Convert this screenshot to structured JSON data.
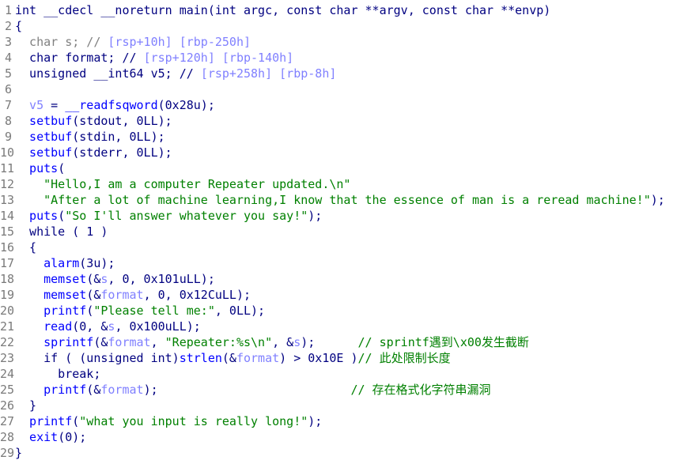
{
  "colors": {
    "keyword": "#000080",
    "function": "#0000ff",
    "variable": "#8080ff",
    "string": "#008000",
    "comment": "#008000",
    "gray": "#808080"
  },
  "lines": [
    [
      [
        "k",
        "int __cdecl __noreturn main(int argc, const char **argv, const char **envp)"
      ]
    ],
    [
      [
        "k",
        "{"
      ]
    ],
    [
      [
        "g",
        "  char s; // "
      ],
      [
        "a",
        "[rsp+10h] [rbp-250h]"
      ]
    ],
    [
      [
        "k",
        "  char format; // "
      ],
      [
        "a",
        "[rsp+120h] [rbp-140h]"
      ]
    ],
    [
      [
        "k",
        "  unsigned __int64 v5; // "
      ],
      [
        "a",
        "[rsp+258h] [rbp-8h]"
      ]
    ],
    [
      [
        "k",
        ""
      ]
    ],
    [
      [
        "v",
        "  v5"
      ],
      [
        "k",
        " = "
      ],
      [
        "f",
        "__readfsqword"
      ],
      [
        "k",
        "(0x28u);"
      ]
    ],
    [
      [
        "f",
        "  setbuf"
      ],
      [
        "k",
        "(stdout, 0LL);"
      ]
    ],
    [
      [
        "f",
        "  setbuf"
      ],
      [
        "k",
        "(stdin, 0LL);"
      ]
    ],
    [
      [
        "f",
        "  setbuf"
      ],
      [
        "k",
        "(stderr, 0LL);"
      ]
    ],
    [
      [
        "f",
        "  puts"
      ],
      [
        "k",
        "("
      ]
    ],
    [
      [
        "s",
        "    \"Hello,I am a computer Repeater updated.\\n\""
      ]
    ],
    [
      [
        "s",
        "    \"After a lot of machine learning,I know that the essence of man is a reread machine!\""
      ],
      [
        "k",
        ");"
      ]
    ],
    [
      [
        "f",
        "  puts"
      ],
      [
        "k",
        "("
      ],
      [
        "s",
        "\"So I'll answer whatever you say!\""
      ],
      [
        "k",
        ");"
      ]
    ],
    [
      [
        "k",
        "  while ( 1 )"
      ]
    ],
    [
      [
        "k",
        "  {"
      ]
    ],
    [
      [
        "f",
        "    alarm"
      ],
      [
        "k",
        "(3u);"
      ]
    ],
    [
      [
        "f",
        "    memset"
      ],
      [
        "k",
        "(&"
      ],
      [
        "v",
        "s"
      ],
      [
        "k",
        ", 0, 0x101uLL);"
      ]
    ],
    [
      [
        "f",
        "    memset"
      ],
      [
        "k",
        "(&"
      ],
      [
        "v",
        "format"
      ],
      [
        "k",
        ", 0, 0x12CuLL);"
      ]
    ],
    [
      [
        "f",
        "    printf"
      ],
      [
        "k",
        "("
      ],
      [
        "s",
        "\"Please tell me:\""
      ],
      [
        "k",
        ", 0LL);"
      ]
    ],
    [
      [
        "f",
        "    read"
      ],
      [
        "k",
        "(0, &"
      ],
      [
        "v",
        "s"
      ],
      [
        "k",
        ", 0x100uLL);"
      ]
    ],
    [
      [
        "f",
        "    sprintf"
      ],
      [
        "k",
        "(&"
      ],
      [
        "v",
        "format"
      ],
      [
        "k",
        ", "
      ],
      [
        "s",
        "\"Repeater:%s\\n\""
      ],
      [
        "k",
        ", &"
      ],
      [
        "v",
        "s"
      ],
      [
        "k",
        ");      "
      ],
      [
        "c",
        "// sprintf遇到\\x00发生截断"
      ]
    ],
    [
      [
        "k",
        "    if ( (unsigned int)"
      ],
      [
        "f",
        "strlen"
      ],
      [
        "k",
        "(&"
      ],
      [
        "v",
        "format"
      ],
      [
        "k",
        ") > 0x10E )"
      ],
      [
        "c",
        "// 此处限制长度"
      ]
    ],
    [
      [
        "k",
        "      break;"
      ]
    ],
    [
      [
        "f",
        "    printf"
      ],
      [
        "k",
        "(&"
      ],
      [
        "v",
        "format"
      ],
      [
        "k",
        ");                           "
      ],
      [
        "c",
        "// 存在格式化字符串漏洞"
      ]
    ],
    [
      [
        "k",
        "  }"
      ]
    ],
    [
      [
        "f",
        "  printf"
      ],
      [
        "k",
        "("
      ],
      [
        "s",
        "\"what you input is really long!\""
      ],
      [
        "k",
        ");"
      ]
    ],
    [
      [
        "f",
        "  exit"
      ],
      [
        "k",
        "(0);"
      ]
    ],
    [
      [
        "k",
        "}"
      ]
    ]
  ],
  "line_numbers": [
    "1",
    "2",
    "3",
    "4",
    "5",
    "6",
    "7",
    "8",
    "9",
    "10",
    "11",
    "12",
    "13",
    "14",
    "15",
    "16",
    "17",
    "18",
    "19",
    "20",
    "21",
    "22",
    "23",
    "24",
    "25",
    "26",
    "27",
    "28",
    "29"
  ]
}
